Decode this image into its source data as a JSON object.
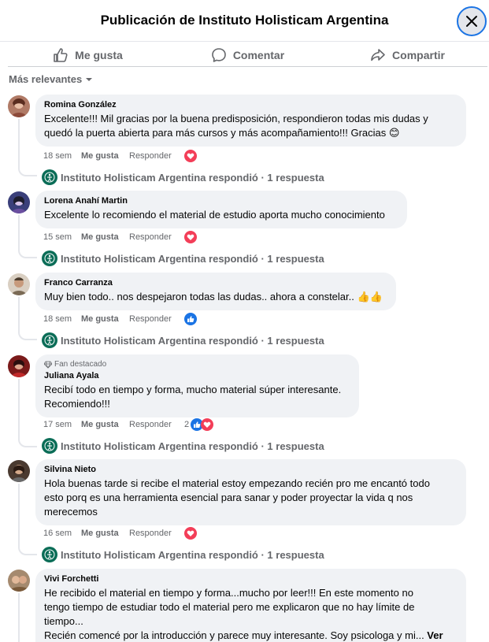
{
  "header": {
    "title": "Publicación de Instituto Holisticam Argentina"
  },
  "actions": {
    "like": "Me gusta",
    "comment": "Comentar",
    "share": "Compartir"
  },
  "sort": {
    "label": "Más relevantes"
  },
  "colors": {
    "accent": "#1b74e4",
    "bubble": "#f0f2f5",
    "muted": "#65676b",
    "org_green": "#0b6d57",
    "love": "#f33e58"
  },
  "comments": [
    {
      "author": "Romina González",
      "text": "Excelente!!! Mil gracias por la buena predisposición, respondieron todas mis dudas y\nquedó la puerta abierta para más cursos y más acompañamiento!!! Gracias 😊",
      "time": "18 sem",
      "like": "Me gusta",
      "reply": "Responder",
      "reaction": "love-icon",
      "replies": "Instituto Holisticam Argentina respondió · 1 respuesta"
    },
    {
      "author": "Lorena Anahí Martin",
      "text": "Excelente lo recomiendo el material de estudio aporta mucho conocimiento",
      "time": "15 sem",
      "like": "Me gusta",
      "reply": "Responder",
      "reaction": "love-icon",
      "replies": "Instituto Holisticam Argentina respondió · 1 respuesta"
    },
    {
      "author": "Franco Carranza",
      "text": "Muy bien todo.. nos despejaron todas las dudas.. ahora a constelar.. 👍👍",
      "time": "18 sem",
      "like": "Me gusta",
      "reply": "Responder",
      "reaction": "like-icon",
      "replies": "Instituto Holisticam Argentina respondió · 1 respuesta"
    },
    {
      "fan_badge": "Fan destacado",
      "author": "Juliana Ayala",
      "text": "Recibí todo en tiempo y forma, mucho material súper interesante.\nRecomiendo!!!",
      "time": "17 sem",
      "like": "Me gusta",
      "reply": "Responder",
      "reaction_count": "2",
      "reaction": "like-love-icons",
      "replies": "Instituto Holisticam Argentina respondió · 1 respuesta"
    },
    {
      "author": "Silvina Nieto",
      "text": "Hola buenas tarde si recibe el material estoy empezando recién pro me encantó todo\nesto porq es una herramienta esencial para sanar y poder proyectar la vida q nos\nmerecemos",
      "time": "16 sem",
      "like": "Me gusta",
      "reply": "Responder",
      "reaction": "love-icon",
      "replies": "Instituto Holisticam Argentina respondió · 1 respuesta"
    },
    {
      "author": "Vivi Forchetti",
      "text": "He recibido el material en tiempo y forma...mucho por leer!!! En este momento no\ntengo tiempo de estudiar todo el material pero me explicaron que no hay límite de\ntiempo...\nRecién comencé por la introducción y parece muy interesante. Soy psicologa y mi... ",
      "see_more": "Ver"
    }
  ]
}
